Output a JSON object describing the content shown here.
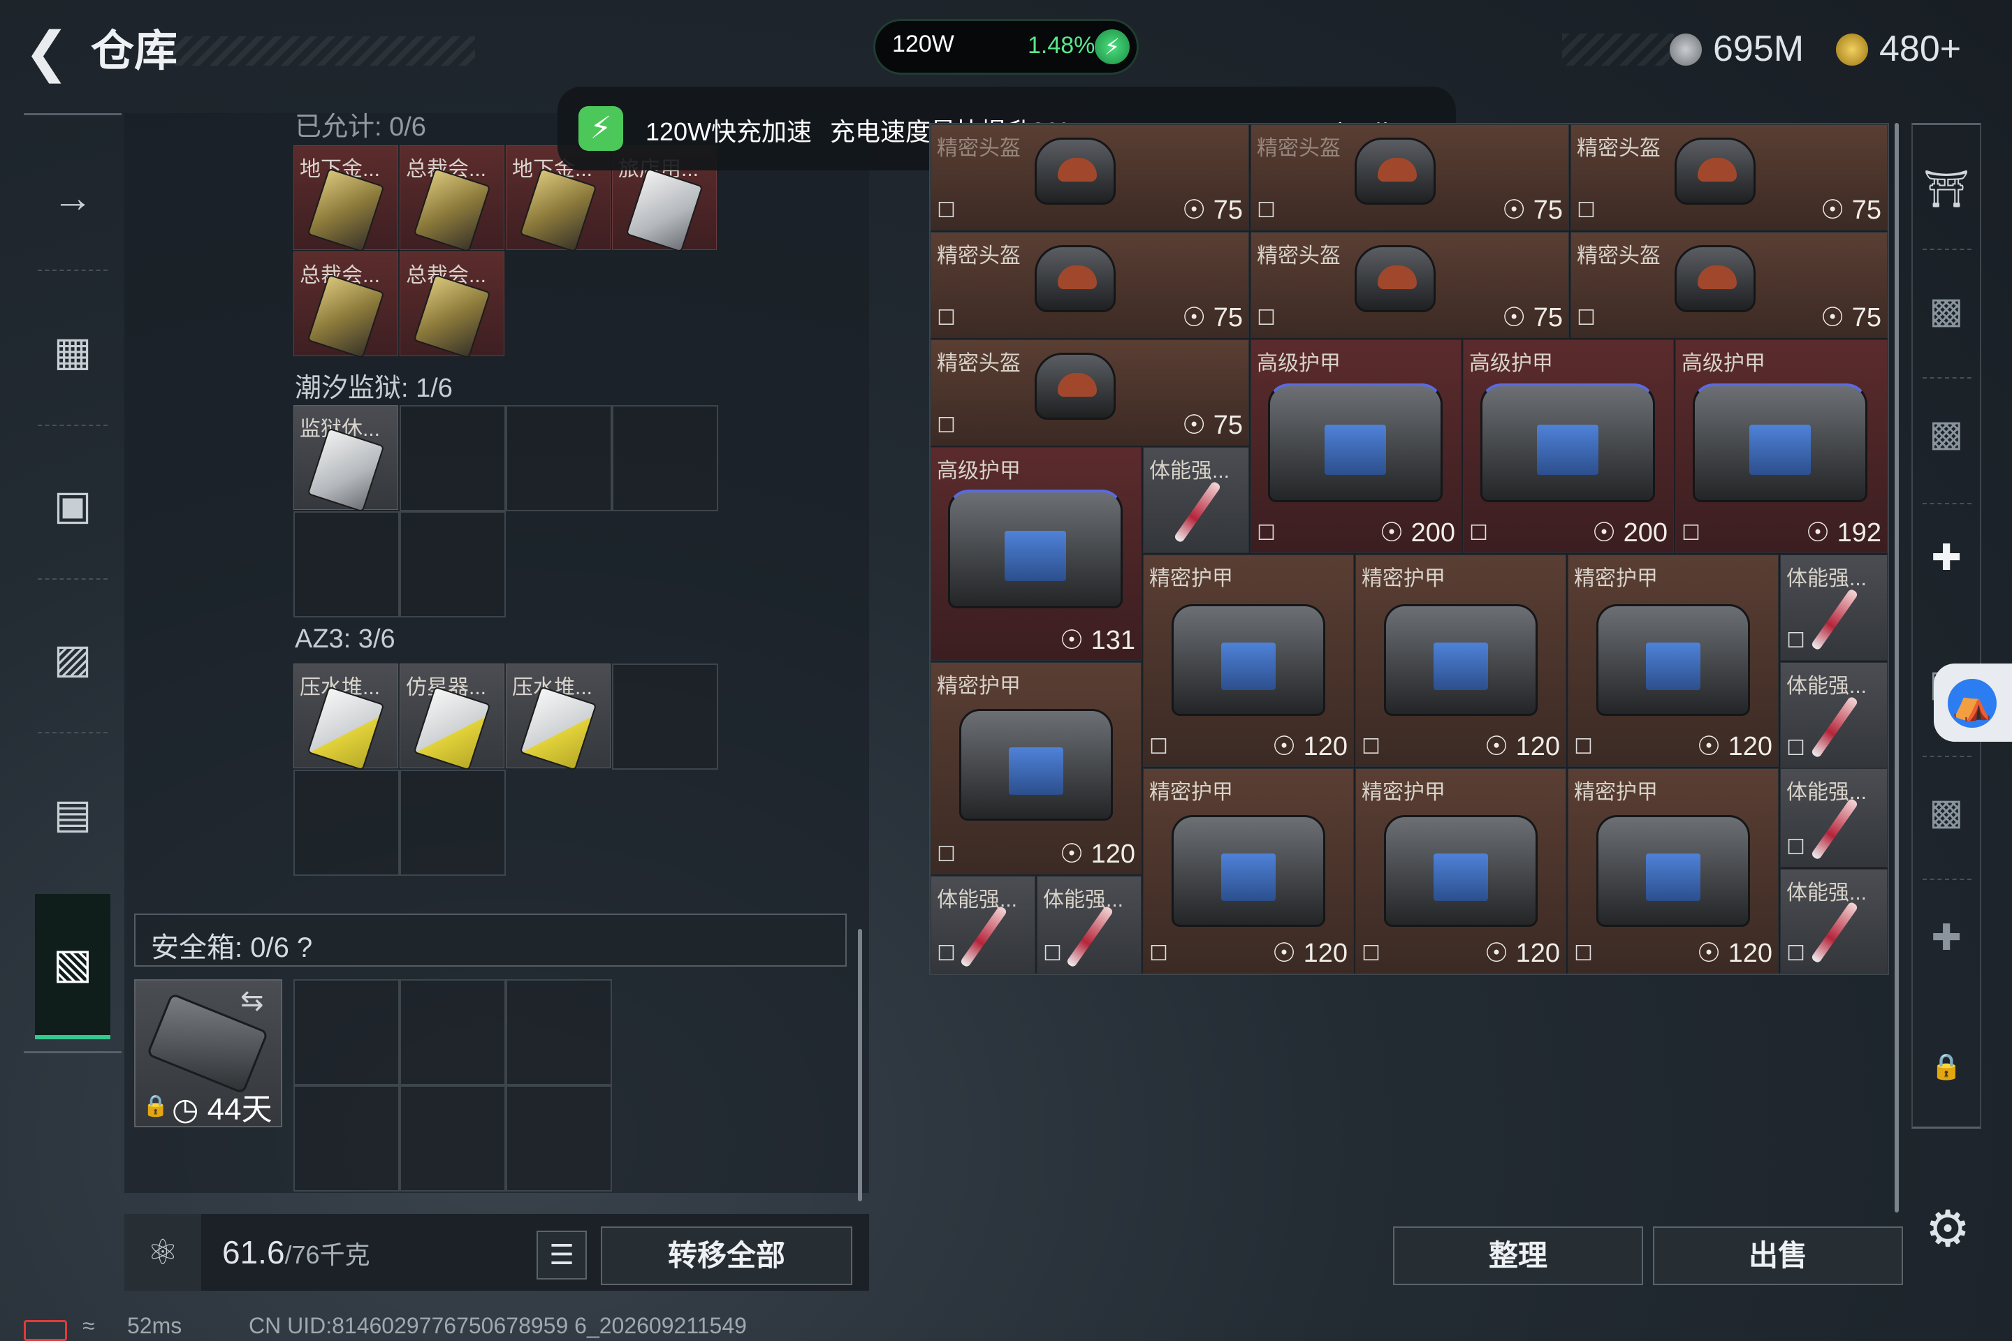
{
  "header": {
    "title": "仓库",
    "back_icon": "back-arrow-icon",
    "currency_silver": "695M",
    "currency_gold": "480+"
  },
  "battery": {
    "watt": "120W",
    "percent": "1.48%"
  },
  "notification": {
    "title": "120W快充加速",
    "text": "充电速度最快提升30%",
    "action": "立即使用"
  },
  "left_rail": {
    "icons": [
      "gun-icon",
      "vest-icon",
      "backpack-icon",
      "bag-icon",
      "container-icon",
      "toolbox-icon"
    ]
  },
  "left_panel": {
    "cut_label": "已允计: 0/6",
    "items_top": [
      "地下金...",
      "总裁会...",
      "地下金...",
      "旅店用...",
      "总裁会...",
      "总裁会..."
    ],
    "section1": {
      "label": "潮汐监狱: 1/6",
      "items": [
        "监狱休..."
      ]
    },
    "section2": {
      "label": "AZ3: 3/6",
      "items": [
        "压水堆...",
        "仿星器...",
        "压水堆..."
      ]
    },
    "safe": {
      "label": "安全箱: 0/6",
      "help": "?",
      "days": "44天"
    },
    "weight": {
      "value": "61.6",
      "capacity": "/76千克"
    },
    "transfer_all": "转移全部"
  },
  "right_grid": {
    "items": [
      {
        "name": "精密头盔",
        "value": "75"
      },
      {
        "name": "精密头盔",
        "value": "75"
      },
      {
        "name": "精密头盔",
        "value": "75"
      },
      {
        "name": "精密头盔",
        "value": "75"
      },
      {
        "name": "精密头盔",
        "value": "75"
      },
      {
        "name": "精密头盔",
        "value": "75"
      },
      {
        "name": "精密头盔",
        "value": "75"
      },
      {
        "name": "高级护甲",
        "value": "200"
      },
      {
        "name": "高级护甲",
        "value": "200"
      },
      {
        "name": "高级护甲",
        "value": "192"
      },
      {
        "name": "高级护甲",
        "value": "131"
      },
      {
        "name": "体能强...",
        "value": ""
      },
      {
        "name": "精密护甲",
        "value": "120"
      },
      {
        "name": "精密护甲",
        "value": "120"
      },
      {
        "name": "精密护甲",
        "value": "120"
      },
      {
        "name": "体能强...",
        "value": ""
      },
      {
        "name": "精密护甲",
        "value": "120"
      },
      {
        "name": "体能强...",
        "value": ""
      },
      {
        "name": "精密护甲",
        "value": "120"
      },
      {
        "name": "精密护甲",
        "value": "120"
      },
      {
        "name": "精密护甲",
        "value": "120"
      },
      {
        "name": "体能强...",
        "value": ""
      },
      {
        "name": "体能强...",
        "value": ""
      },
      {
        "name": "体能强...",
        "value": ""
      },
      {
        "name": "体能强...",
        "value": ""
      }
    ],
    "arrange": "整理",
    "sell": "出售"
  },
  "right_rail": {
    "icons": [
      "helmet-tab-icon",
      "v-container-icon",
      "iii-container-icon",
      "iv-med-icon",
      "iv-container-icon",
      "iii-container-icon",
      "iv-med-icon",
      "lock-icon"
    ]
  },
  "status": {
    "ping": "52ms",
    "uid": "CN UID:8146029776750678959 6_202609211549"
  }
}
